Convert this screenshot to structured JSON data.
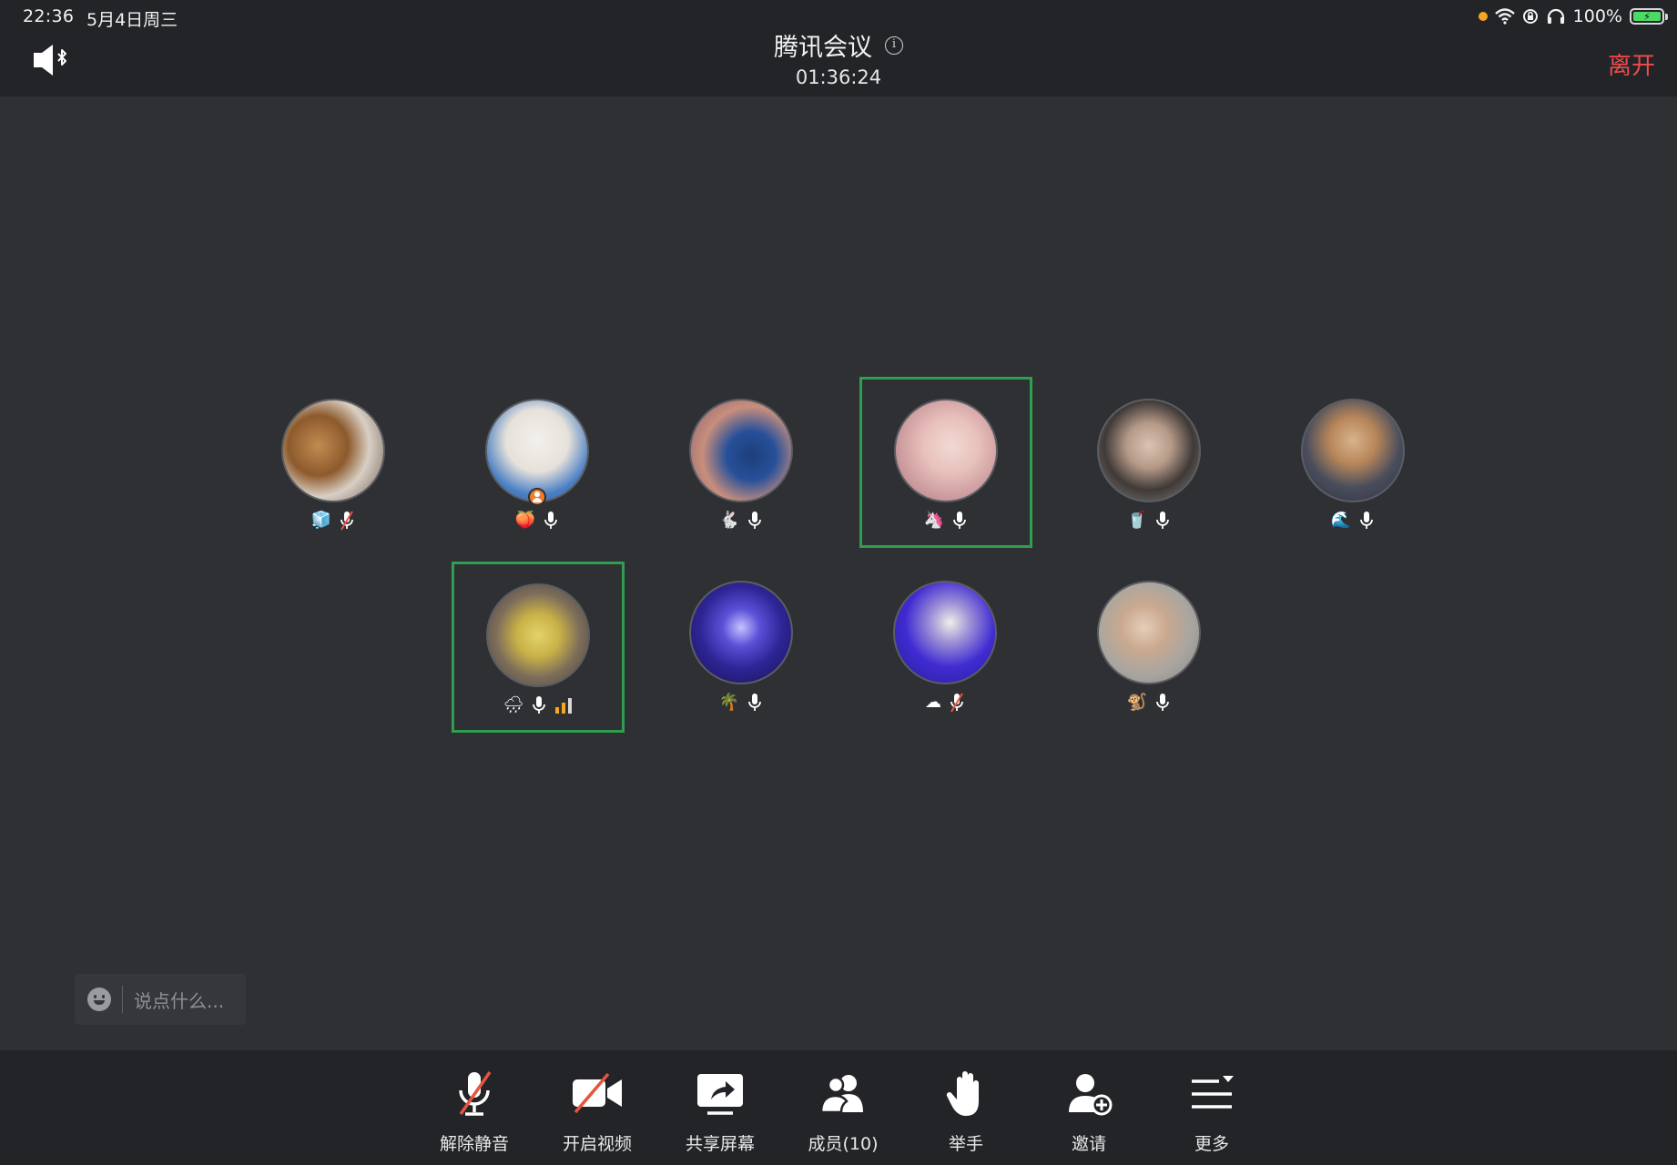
{
  "status_bar": {
    "time": "22:36",
    "date": "5月4日周三",
    "battery": "100%"
  },
  "header": {
    "title": "腾讯会议",
    "timer": "01:36:24",
    "leave": "离开",
    "speaker_icon": "speaker-bluetooth-icon",
    "info_icon": "info-icon"
  },
  "participants": [
    {
      "emoji": "🧊",
      "mic": "muted",
      "host": false,
      "speaking": false
    },
    {
      "emoji": "🍑",
      "mic": "on",
      "host": true,
      "speaking": false
    },
    {
      "emoji": "🐇",
      "mic": "on",
      "host": false,
      "speaking": false
    },
    {
      "emoji": "🦄",
      "mic": "on",
      "host": false,
      "speaking": true
    },
    {
      "emoji": "🥤",
      "mic": "on",
      "host": false,
      "speaking": false
    },
    {
      "emoji": "🌊",
      "mic": "on",
      "host": false,
      "speaking": false
    },
    {
      "emoji": "🌧",
      "mic": "on",
      "host": false,
      "speaking": true,
      "signal": true
    },
    {
      "emoji": "🌴",
      "mic": "on",
      "host": false,
      "speaking": false
    },
    {
      "emoji": "☁",
      "mic": "muted",
      "host": false,
      "speaking": false
    },
    {
      "emoji": "🐒",
      "mic": "on",
      "host": false,
      "speaking": false
    }
  ],
  "chat": {
    "placeholder": "说点什么..."
  },
  "toolbar": {
    "unmute": "解除静音",
    "video": "开启视频",
    "share": "共享屏幕",
    "members": "成员(10)",
    "raise_hand": "举手",
    "invite": "邀请",
    "more": "更多"
  },
  "colors": {
    "accent_green": "#2f9e50",
    "mic_green": "#3ec35a",
    "leave_red": "#f04b4b",
    "mute_red": "#e5553f"
  }
}
